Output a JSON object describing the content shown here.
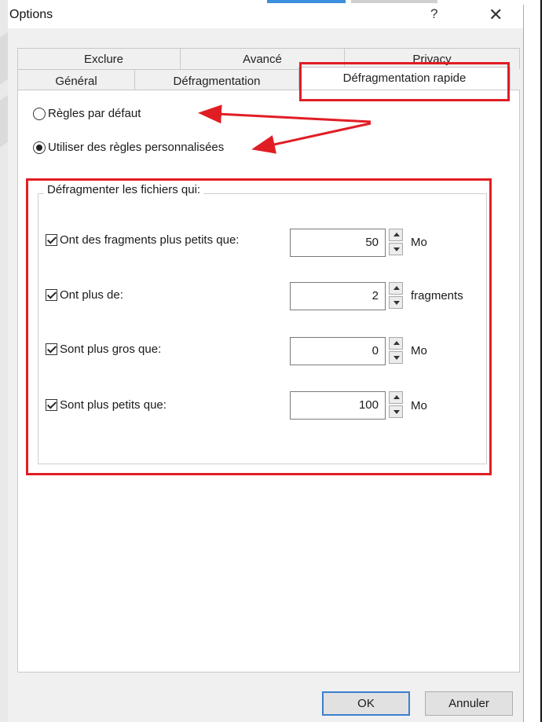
{
  "dialog": {
    "title": "Options",
    "help_glyph": "?",
    "close_glyph": "✕"
  },
  "tabs": {
    "row1": [
      "Exclure",
      "Avancé",
      "Privacy"
    ],
    "row2": [
      "Général",
      "Défragmentation",
      "Défragmentation rapide"
    ],
    "active": "Défragmentation rapide"
  },
  "rules": {
    "default_label": "Règles par défaut",
    "custom_label": "Utiliser des règles personnalisées",
    "selected": "custom"
  },
  "group": {
    "legend": "Défragmenter les fichiers qui:",
    "rows": [
      {
        "label": "Ont des fragments plus petits que:",
        "value": "50",
        "unit": "Mo",
        "checked": true
      },
      {
        "label": "Ont plus de:",
        "value": "2",
        "unit": "fragments",
        "checked": true
      },
      {
        "label": "Sont plus gros que:",
        "value": "0",
        "unit": "Mo",
        "checked": true
      },
      {
        "label": "Sont plus petits que:",
        "value": "100",
        "unit": "Mo",
        "checked": true
      }
    ]
  },
  "buttons": {
    "ok": "OK",
    "cancel": "Annuler"
  },
  "colors": {
    "annotation": "#e11d24",
    "primary_border": "#3c7fd0"
  }
}
